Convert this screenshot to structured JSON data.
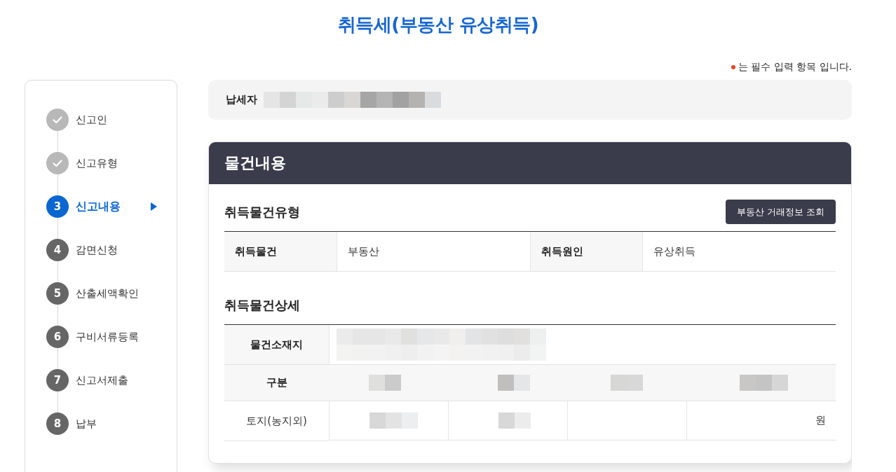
{
  "page_title": "취득세(부동산 유상취득)",
  "required_note": "는 필수 입력 항목 입니다.",
  "steps": [
    {
      "label": "신고인",
      "completed": true,
      "current": false
    },
    {
      "label": "신고유형",
      "completed": true,
      "current": false
    },
    {
      "number": "3",
      "label": "신고내용",
      "completed": false,
      "current": true
    },
    {
      "number": "4",
      "label": "감면신청",
      "completed": false,
      "current": false
    },
    {
      "number": "5",
      "label": "산출세액확인",
      "completed": false,
      "current": false
    },
    {
      "number": "6",
      "label": "구비서류등록",
      "completed": false,
      "current": false
    },
    {
      "number": "7",
      "label": "신고서제출",
      "completed": false,
      "current": false
    },
    {
      "number": "8",
      "label": "납부",
      "completed": false,
      "current": false
    }
  ],
  "taxpayer": {
    "label": "납세자"
  },
  "panel": {
    "title": "물건내용",
    "type_section": {
      "title": "취득물건유형",
      "button": "부동산 거래정보 조회",
      "fields": [
        {
          "label": "취득물건",
          "value": "부동산"
        },
        {
          "label": "취득원인",
          "value": "유상취득"
        }
      ]
    },
    "detail_section": {
      "title": "취득물건상세",
      "location_label": "물건소재지",
      "category_label": "구분",
      "rows": [
        {
          "label": "토지(농지외)",
          "unit": "원"
        }
      ]
    }
  }
}
